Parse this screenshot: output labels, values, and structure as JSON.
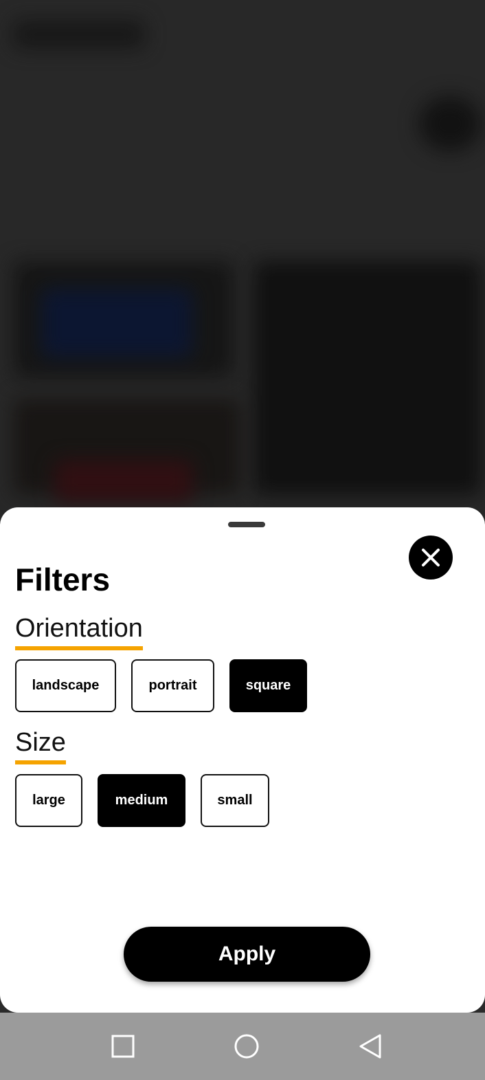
{
  "sheet": {
    "title": "Filters",
    "orientation": {
      "label": "Orientation",
      "options": [
        "landscape",
        "portrait",
        "square"
      ],
      "selected": "square"
    },
    "size": {
      "label": "Size",
      "options": [
        "large",
        "medium",
        "small"
      ],
      "selected": "medium"
    },
    "apply_label": "Apply"
  },
  "icons": {
    "close": "close-icon",
    "handle": "drag-handle",
    "nav_recents": "square-icon",
    "nav_home": "circle-icon",
    "nav_back": "triangle-back-icon"
  },
  "colors": {
    "accent_underline": "#f5a300",
    "selected_chip": "#000000",
    "navbar": "#9b9b9b"
  }
}
